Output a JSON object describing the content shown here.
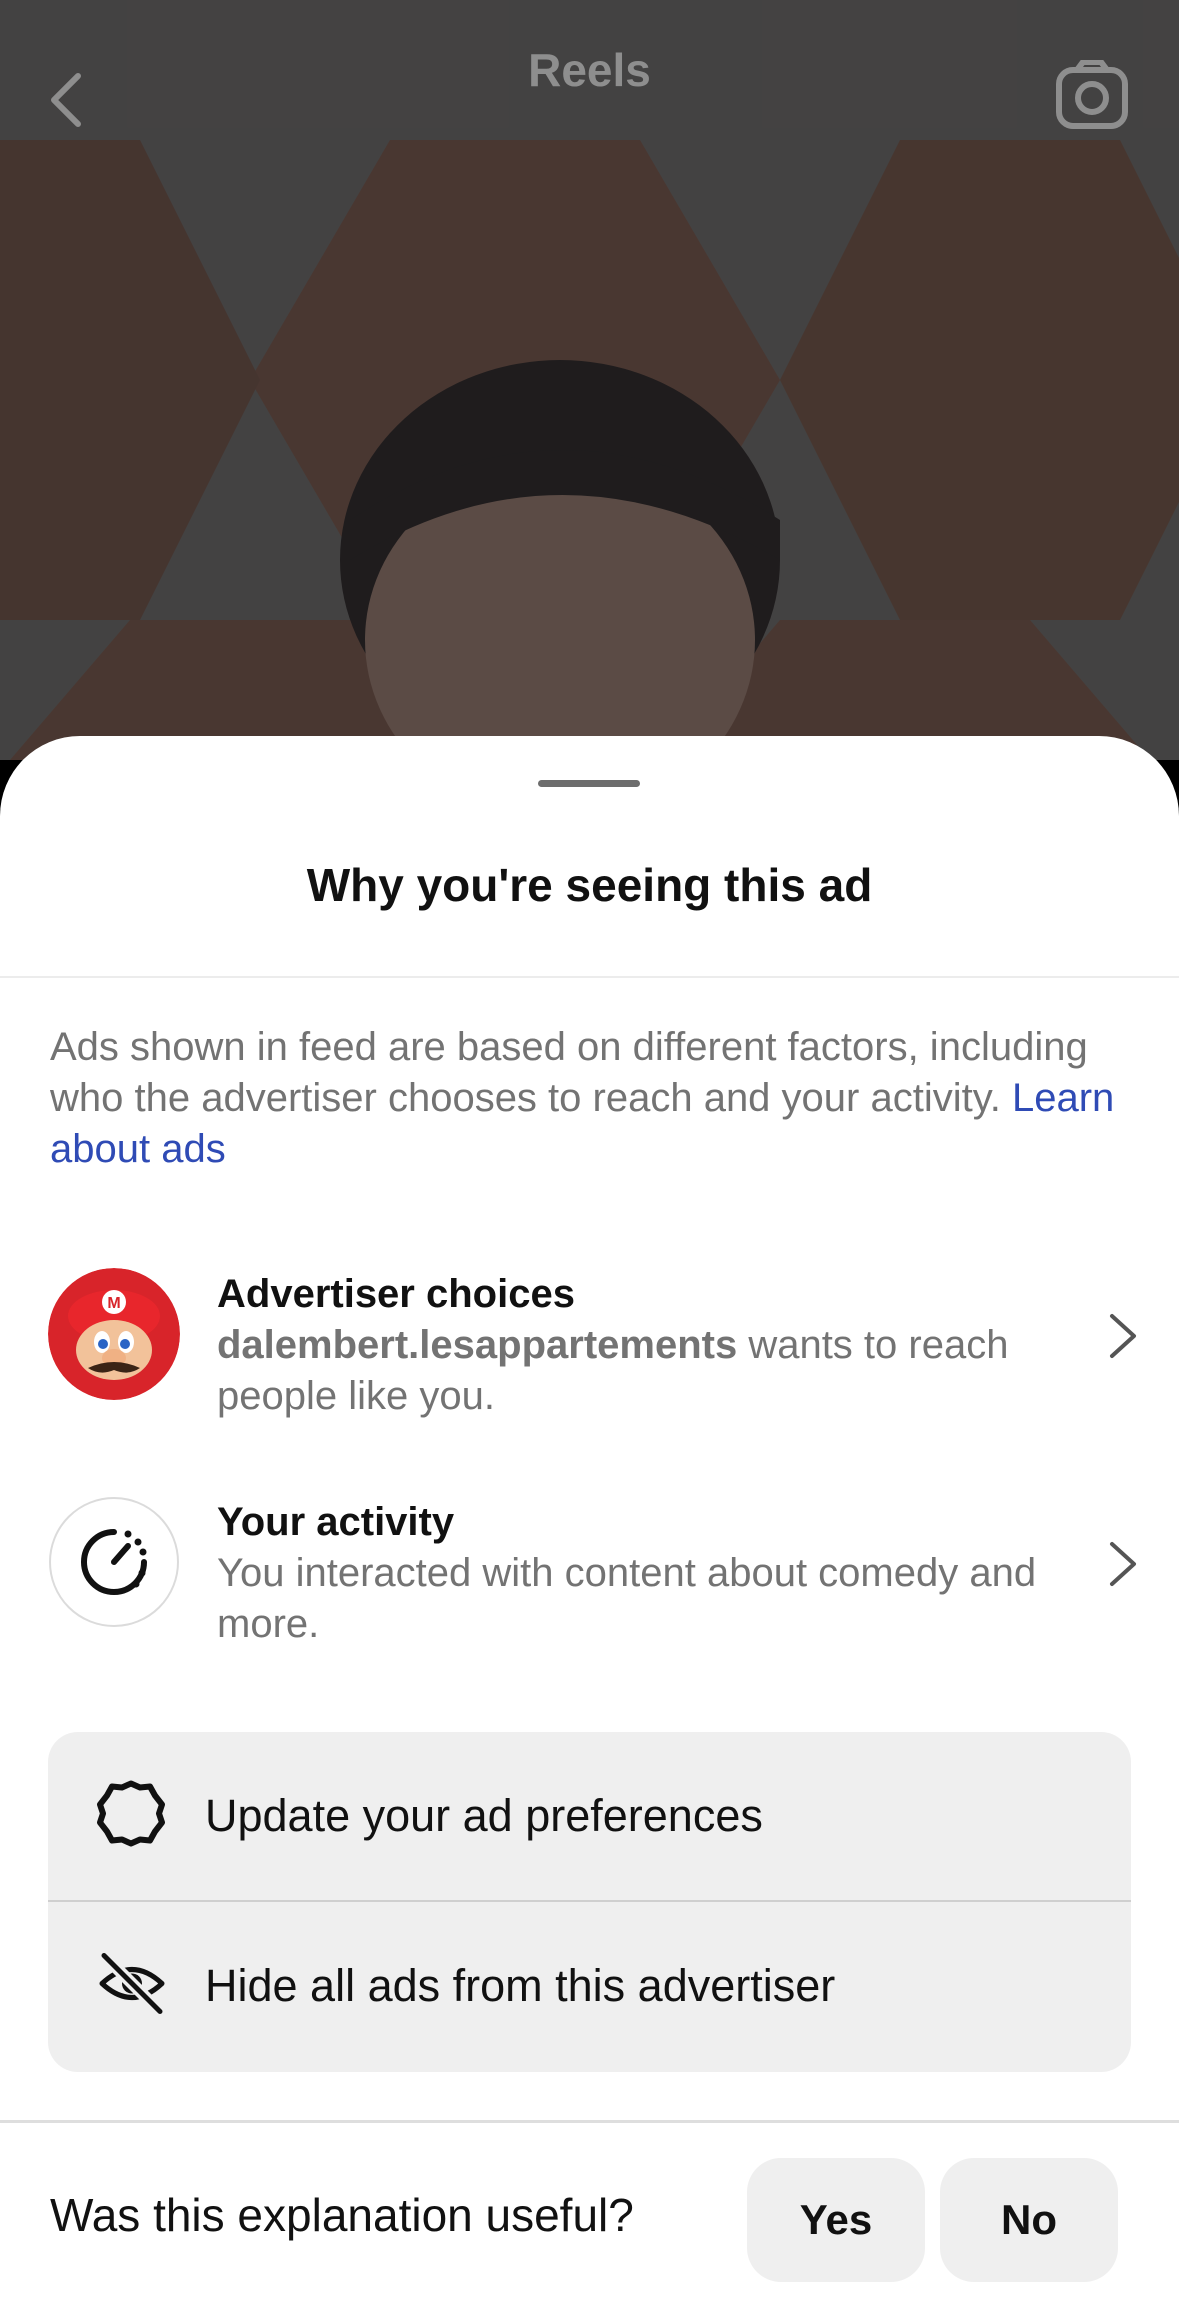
{
  "header": {
    "title": "Reels",
    "back_icon": "chevron-left-icon",
    "camera_icon": "camera-icon"
  },
  "sheet": {
    "title": "Why you're seeing this ad",
    "intro_text": "Ads shown in feed are based on different factors, including who the advertiser chooses to reach and your activity.",
    "intro_link": "Learn about ads",
    "advertiser": {
      "heading": "Advertiser choices",
      "account": "dalembert.lesappartements",
      "description": " wants to reach people like you.",
      "avatar_icon": "mario-avatar"
    },
    "activity": {
      "heading": "Your activity",
      "description": "You interacted with content about comedy and more.",
      "icon": "activity-timer-icon"
    },
    "options": [
      {
        "label": "Update your ad preferences",
        "icon": "gear-icon"
      },
      {
        "label": "Hide all ads from this advertiser",
        "icon": "eye-off-icon"
      }
    ],
    "feedback": {
      "question": "Was this explanation useful?",
      "yes": "Yes",
      "no": "No"
    }
  },
  "colors": {
    "link": "#2f4bb5",
    "secondary_text": "#737373",
    "option_bg": "#efefef",
    "mario_red": "#d8242a"
  }
}
